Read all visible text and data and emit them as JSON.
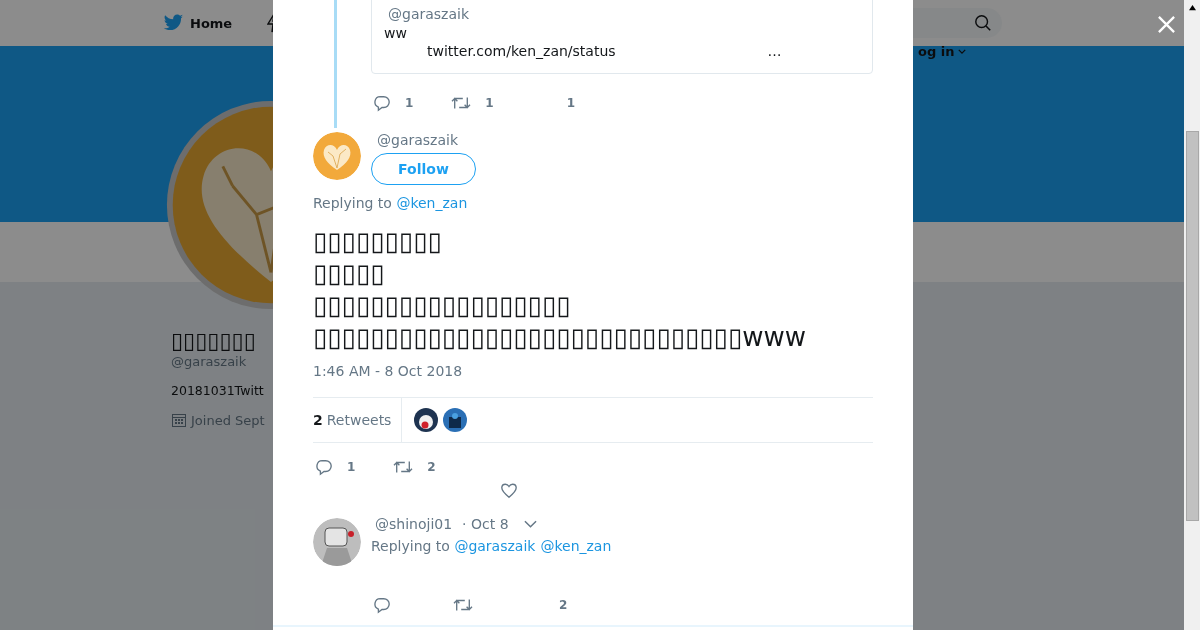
{
  "background": {
    "nav": {
      "home": "Home",
      "login": "og in"
    },
    "profile": {
      "name": "▯▯▯▯▯▯▯",
      "handle": "@garaszaik",
      "bio": "20181031Twitt",
      "joined": "Joined Sept"
    }
  },
  "quoted": {
    "handle": "@garaszaik",
    "text": "ww",
    "link": "twitter.com/ken_zan/status",
    "more": "…",
    "actions": {
      "replies": "1",
      "retweets": "1",
      "likes": "1"
    }
  },
  "tweet": {
    "handle": "@garaszaik",
    "follow": "Follow",
    "replying_label": "Replying to",
    "replying_to": [
      "@ken_zan"
    ],
    "lines": [
      "▯▯▯▯▯▯▯▯▯",
      "▯▯▯▯▯",
      "▯▯▯▯▯▯▯▯▯▯▯▯▯▯▯▯▯▯",
      "▯▯▯▯▯▯▯▯▯▯▯▯▯▯▯▯▯▯▯▯▯▯▯▯▯▯▯▯▯▯www"
    ],
    "time": "1:46 AM - 8 Oct 2018",
    "retweets": {
      "count": "2",
      "label": "Retweets"
    },
    "actions": {
      "replies": "1",
      "retweets": "2"
    }
  },
  "reply": {
    "handle": "@shinoji01",
    "date": "· Oct 8",
    "replying_label": "Replying to",
    "replying_to": [
      "@garaszaik",
      "@ken_zan"
    ],
    "actions": {
      "likes": "2"
    }
  }
}
